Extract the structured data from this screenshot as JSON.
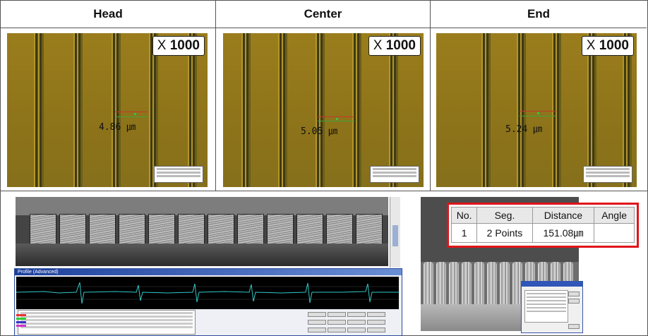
{
  "columns": [
    {
      "label": "Head",
      "measurement": "4.86 ㎛",
      "magnification_prefix": "X",
      "magnification_value": "1000"
    },
    {
      "label": "Center",
      "measurement": "5.05 ㎛",
      "magnification_prefix": "X",
      "magnification_value": "1000"
    },
    {
      "label": "End",
      "measurement": "5.24 ㎛",
      "magnification_prefix": "X",
      "magnification_value": "1000"
    }
  ],
  "profile_window": {
    "title": "Profile (Advanced)"
  },
  "result_table": {
    "headers": [
      "No.",
      "Seg.",
      "Distance",
      "Angle"
    ],
    "rows": [
      [
        "1",
        "2 Points",
        "151.08㎛",
        ""
      ]
    ]
  },
  "colors": {
    "accent_red": "#e0141b",
    "micrograph": "#8d731a"
  }
}
